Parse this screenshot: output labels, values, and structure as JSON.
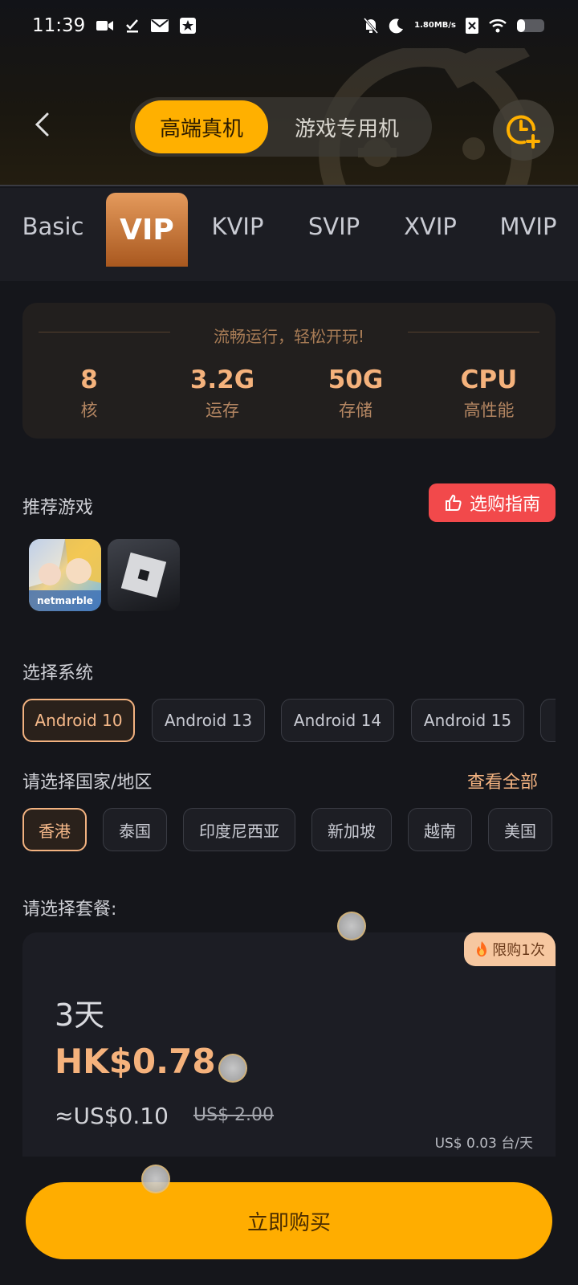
{
  "status_bar": {
    "time": "11:39",
    "net_speed_value": "1.80",
    "net_speed_unit": "MB/s"
  },
  "header": {
    "segments": [
      "高端真机",
      "游戏专用机"
    ],
    "active_segment": 0
  },
  "tiers": {
    "items": [
      "Basic",
      "VIP",
      "KVIP",
      "SVIP",
      "XVIP",
      "MVIP"
    ],
    "active": "VIP"
  },
  "specs": {
    "slogan": "流畅运行，轻松开玩!",
    "items": [
      {
        "value": "8",
        "label": "核"
      },
      {
        "value": "3.2G",
        "label": "运存"
      },
      {
        "value": "50G",
        "label": "存储"
      },
      {
        "value": "CPU",
        "label": "高性能"
      }
    ]
  },
  "recommend": {
    "title": "推荐游戏",
    "guide_label": "选购指南",
    "games": [
      {
        "name": "netmarble",
        "icon": "netmarble-game-icon"
      },
      {
        "name": "",
        "icon": "roblox-game-icon"
      }
    ]
  },
  "system": {
    "title": "选择系统",
    "options": [
      "Android 10",
      "Android 13",
      "Android 14",
      "Android 15"
    ],
    "selected": "Android 10"
  },
  "region": {
    "title": "请选择国家/地区",
    "see_all": "查看全部",
    "options": [
      "香港",
      "泰国",
      "印度尼西亚",
      "新加坡",
      "越南",
      "美国"
    ],
    "selected": "香港"
  },
  "plan": {
    "title": "请选择套餐:",
    "badge": "限购1次",
    "days": "3天",
    "price": "HK$0.78",
    "usd": "≈US$0.10",
    "original": "US$ 2.00",
    "daily": "US$ 0.03 台/天"
  },
  "buy_button": "立即购买",
  "colors": {
    "accent": "#ffad00",
    "vip": "#c06a2c",
    "guide": "#f2494b"
  }
}
